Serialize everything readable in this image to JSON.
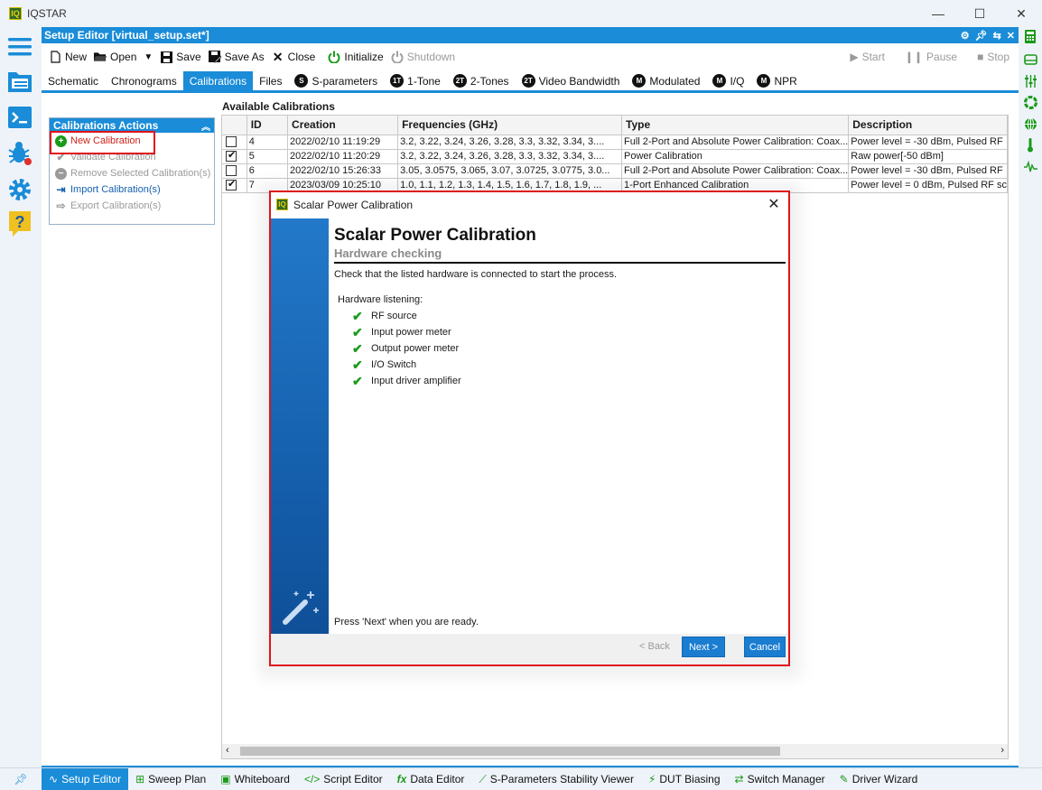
{
  "app": {
    "title": "IQSTAR",
    "logo_text": "IQ"
  },
  "editor": {
    "title": "Setup Editor [virtual_setup.set*]"
  },
  "toolbar": {
    "new": "New",
    "open": "Open",
    "save": "Save",
    "save_as": "Save As",
    "close": "Close",
    "initialize": "Initialize",
    "shutdown": "Shutdown",
    "start": "Start",
    "pause": "Pause",
    "stop": "Stop"
  },
  "tabs": [
    {
      "label": "Schematic"
    },
    {
      "label": "Chronograms"
    },
    {
      "label": "Calibrations"
    },
    {
      "label": "Files"
    },
    {
      "label": "S-parameters",
      "badge": "S"
    },
    {
      "label": "1-Tone",
      "badge": "1T"
    },
    {
      "label": "2-Tones",
      "badge": "2T"
    },
    {
      "label": "Video Bandwidth",
      "badge": "2T"
    },
    {
      "label": "Modulated",
      "badge": "M"
    },
    {
      "label": "I/Q",
      "badge": "M"
    },
    {
      "label": "NPR",
      "badge": "M"
    }
  ],
  "actions": {
    "header": "Calibrations Actions",
    "items": [
      {
        "label": "New Calibration"
      },
      {
        "label": "Validate Calibration"
      },
      {
        "label": "Remove Selected Calibration(s)"
      },
      {
        "label": "Import Calibration(s)"
      },
      {
        "label": "Export Calibration(s)"
      }
    ]
  },
  "table": {
    "title": "Available Calibrations",
    "columns": [
      "ID",
      "Creation",
      "Frequencies (GHz)",
      "Type",
      "Description"
    ],
    "rows": [
      {
        "checked": false,
        "id": "4",
        "creation": "2022/02/10 11:19:29",
        "freqs": "3.2, 3.22, 3.24, 3.26, 3.28, 3.3, 3.32, 3.34, 3....",
        "type": "Full 2-Port and Absolute Power Calibration: Coax...",
        "desc": "Power level = -30 dBm, Pulsed RF"
      },
      {
        "checked": true,
        "id": "5",
        "creation": "2022/02/10 11:20:29",
        "freqs": "3.2, 3.22, 3.24, 3.26, 3.28, 3.3, 3.32, 3.34, 3....",
        "type": "Power Calibration",
        "desc": "Raw power[-50 dBm]"
      },
      {
        "checked": false,
        "id": "6",
        "creation": "2022/02/10 15:26:33",
        "freqs": "3.05, 3.0575, 3.065, 3.07, 3.0725, 3.0775, 3.0...",
        "type": "Full 2-Port and Absolute Power Calibration: Coax...",
        "desc": "Power level = -30 dBm, Pulsed RF"
      },
      {
        "checked": true,
        "id": "7",
        "creation": "2023/03/09 10:25:10",
        "freqs": "1.0, 1.1, 1.2, 1.3, 1.4, 1.5, 1.6, 1.7, 1.8, 1.9, ...",
        "type": "1-Port Enhanced Calibration",
        "desc": "Power level = 0 dBm, Pulsed RF sc"
      }
    ]
  },
  "dialog": {
    "title": "Scalar Power Calibration",
    "heading": "Scalar Power Calibration",
    "subheading": "Hardware checking",
    "intro": "Check that the listed hardware is connected to start the process.",
    "hw_label": "Hardware listening:",
    "hardware": [
      "RF source",
      "Input power meter",
      "Output power meter",
      "I/O Switch",
      "Input driver amplifier"
    ],
    "ready": "Press 'Next' when you are ready.",
    "back": "< Back",
    "next": "Next >",
    "cancel": "Cancel"
  },
  "bottom": [
    {
      "label": "Setup Editor",
      "icon": "pulse-icon"
    },
    {
      "label": "Sweep Plan",
      "icon": "tree-icon"
    },
    {
      "label": "Whiteboard",
      "icon": "chart-icon"
    },
    {
      "label": "Script Editor",
      "icon": "code-icon"
    },
    {
      "label": "Data Editor",
      "icon": "fx-icon"
    },
    {
      "label": "S-Parameters Stability Viewer",
      "icon": "stability-icon"
    },
    {
      "label": "DUT Biasing",
      "icon": "bolt-icon"
    },
    {
      "label": "Switch Manager",
      "icon": "switch-icon"
    },
    {
      "label": "Driver Wizard",
      "icon": "wand-icon"
    }
  ],
  "colors": {
    "accent": "#1a8cd8",
    "highlight": "#e0141a",
    "check": "#1a9a1a"
  }
}
